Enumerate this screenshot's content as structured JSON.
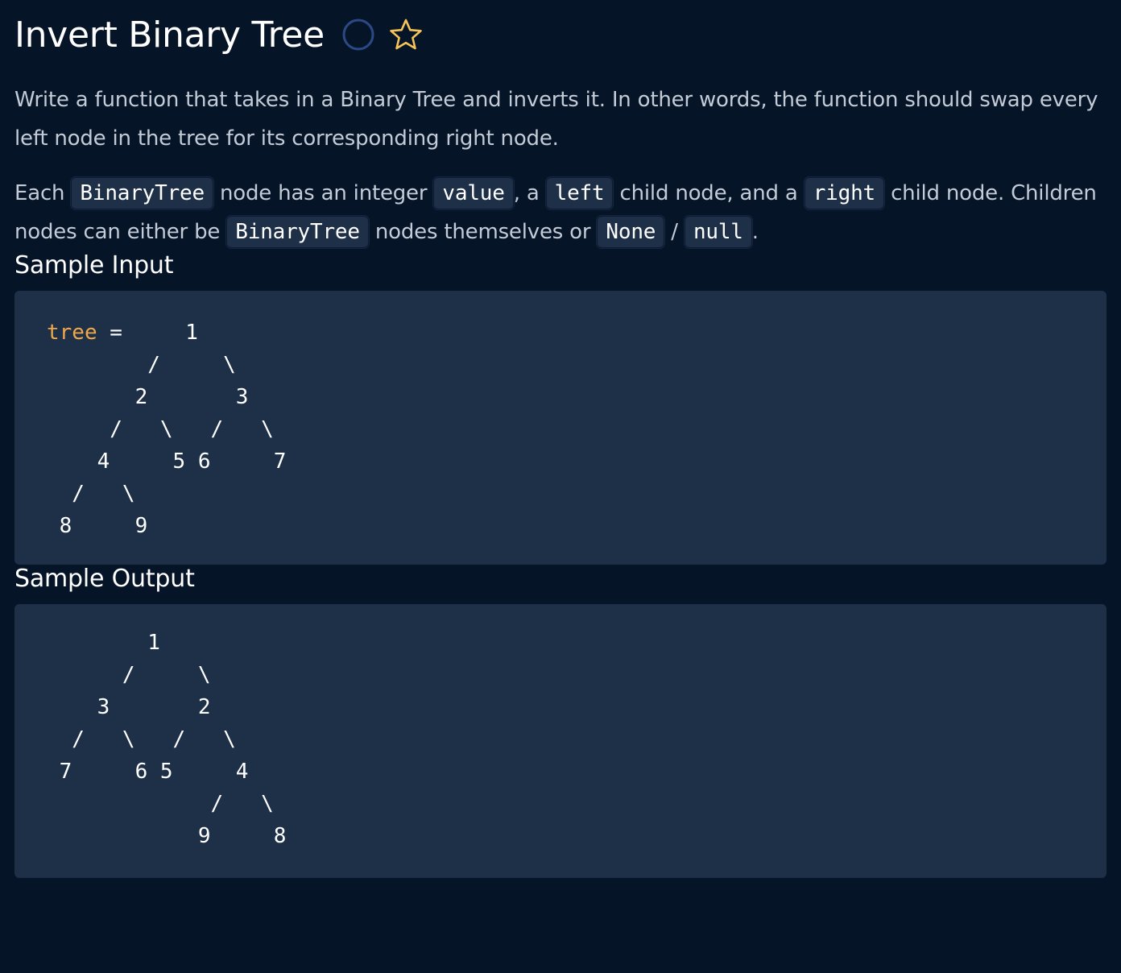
{
  "title": "Invert Binary Tree",
  "icons": {
    "status": "circle-outline-icon",
    "favorite": "star-outline-icon",
    "status_color": "#2b4a85",
    "star_color": "#f5c35a"
  },
  "description": {
    "p1": "Write a function that takes in a Binary Tree and inverts it. In other words, the function should swap every left node in the tree for its corresponding right node.",
    "p2": {
      "t1": "Each ",
      "c1": "BinaryTree",
      "t2": " node has an integer ",
      "c2": "value",
      "t3": ", a ",
      "c3": "left",
      "t4": " child node, and a ",
      "c4": "right",
      "t5": " child node. Children nodes can either be ",
      "c5": "BinaryTree",
      "t6": " nodes themselves or ",
      "c6": "None",
      "t7": " / ",
      "c7": "null",
      "t8": "."
    }
  },
  "sample_input": {
    "heading": "Sample Input",
    "variable": "tree",
    "assign": " =     1\n        /     \\\n       2       3\n     /   \\   /   \\\n    4     5 6     7\n  /   \\\n 8     9"
  },
  "sample_output": {
    "heading": "Sample Output",
    "code": "        1\n      /     \\\n    3       2\n  /   \\   /   \\\n 7     6 5     4\n             /   \\\n            9     8"
  },
  "colors": {
    "background": "#061428",
    "code_background": "#1e2f48",
    "keyword": "#f0a848"
  }
}
